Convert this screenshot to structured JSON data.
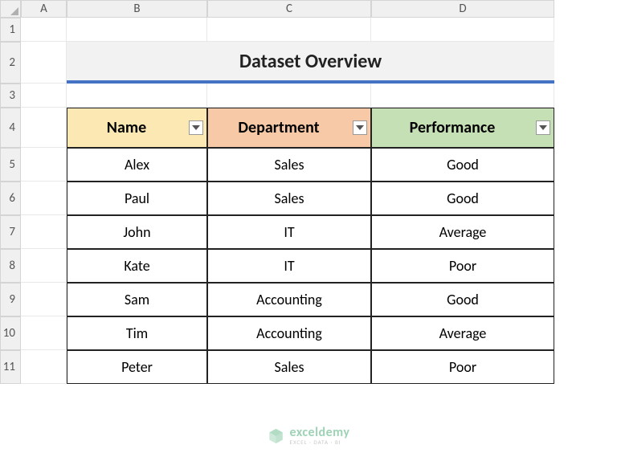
{
  "columns": [
    "A",
    "B",
    "C",
    "D"
  ],
  "rows": [
    "1",
    "2",
    "3",
    "4",
    "5",
    "6",
    "7",
    "8",
    "9",
    "10",
    "11"
  ],
  "title": "Dataset Overview",
  "headers": {
    "name": "Name",
    "department": "Department",
    "performance": "Performance"
  },
  "data": [
    {
      "name": "Alex",
      "department": "Sales",
      "performance": "Good"
    },
    {
      "name": "Paul",
      "department": "Sales",
      "performance": "Good"
    },
    {
      "name": "John",
      "department": "IT",
      "performance": "Average"
    },
    {
      "name": "Kate",
      "department": "IT",
      "performance": "Poor"
    },
    {
      "name": "Sam",
      "department": "Accounting",
      "performance": "Good"
    },
    {
      "name": "Tim",
      "department": "Accounting",
      "performance": "Average"
    },
    {
      "name": "Peter",
      "department": "Sales",
      "performance": "Poor"
    }
  ],
  "watermark": {
    "main": "exceldemy",
    "sub": "EXCEL · DATA · BI"
  },
  "chart_data": {
    "type": "table",
    "title": "Dataset Overview",
    "columns": [
      "Name",
      "Department",
      "Performance"
    ],
    "rows": [
      [
        "Alex",
        "Sales",
        "Good"
      ],
      [
        "Paul",
        "Sales",
        "Good"
      ],
      [
        "John",
        "IT",
        "Average"
      ],
      [
        "Kate",
        "IT",
        "Poor"
      ],
      [
        "Sam",
        "Accounting",
        "Good"
      ],
      [
        "Tim",
        "Accounting",
        "Average"
      ],
      [
        "Peter",
        "Sales",
        "Poor"
      ]
    ]
  }
}
